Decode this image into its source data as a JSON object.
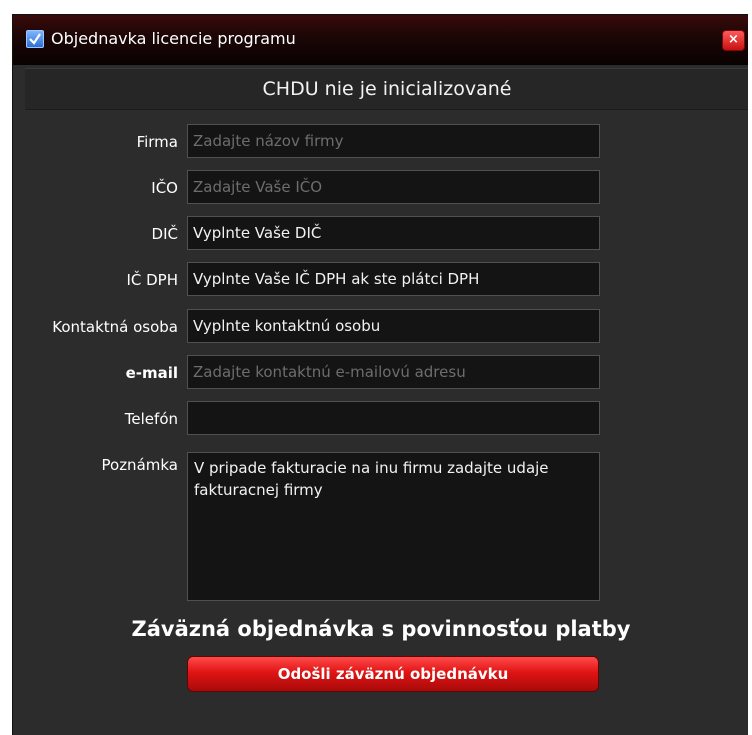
{
  "window": {
    "title": "Objednavka licencie programu",
    "close_label": "×"
  },
  "status": "CHDU nie je inicializované",
  "fields": [
    {
      "label": "Firma",
      "value": "",
      "placeholder": "Zadajte názov firmy"
    },
    {
      "label": "IČO",
      "value": "",
      "placeholder": "Zadajte Vaše IČO"
    },
    {
      "label": "DIČ",
      "value": "Vyplnte Vaše DIČ",
      "placeholder": ""
    },
    {
      "label": "IČ DPH",
      "value": "Vyplnte Vaše IČ DPH ak ste plátci DPH",
      "placeholder": ""
    },
    {
      "label": "Kontaktná osoba",
      "value": "Vyplnte kontaktnú osobu",
      "placeholder": ""
    },
    {
      "label": "e-mail",
      "value": "",
      "placeholder": "Zadajte kontaktnú e-mailovú adresu"
    },
    {
      "label": "Telefón",
      "value": "",
      "placeholder": ""
    }
  ],
  "note": {
    "label": "Poznámka",
    "value": "V pripade fakturacie na inu firmu zadajte udaje fakturacnej firmy"
  },
  "heading": "Záväzná objednávka s povinnosťou platby",
  "submit_label": "Odošli záväznú objednávku",
  "colors": {
    "window_bg": "#2c2c2c",
    "titlebar": "#1b0606",
    "field_bg": "#141414",
    "button_red": "#e01414"
  }
}
